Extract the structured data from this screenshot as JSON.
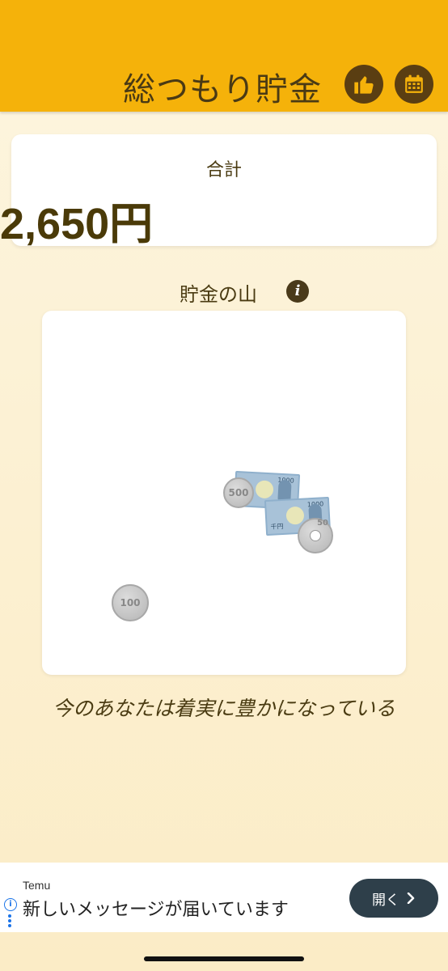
{
  "header": {
    "title": "総つもり貯金",
    "like_icon": "thumbs-up-icon",
    "calendar_icon": "calendar-icon"
  },
  "total": {
    "label": "合計",
    "value": "2,650円"
  },
  "savings_pile": {
    "title": "貯金の山",
    "info_icon": "info-icon",
    "items": [
      "1000-yen-note",
      "1000-yen-note",
      "500-yen-coin",
      "100-yen-coin",
      "50-yen-coin"
    ],
    "note_number": "1000",
    "note_kanji": "千円",
    "coin_500": "500",
    "coin_100": "100",
    "coin_50": "50"
  },
  "message": "今のあなたは着実に豊かになっている",
  "ad": {
    "brand": "Temu",
    "text": "新しいメッセージが届いています",
    "button_label": "開く",
    "info_glyph": "i"
  },
  "colors": {
    "header": "#f5b20a",
    "accent_dark": "#5a3e12",
    "background": "#fdf5df"
  }
}
